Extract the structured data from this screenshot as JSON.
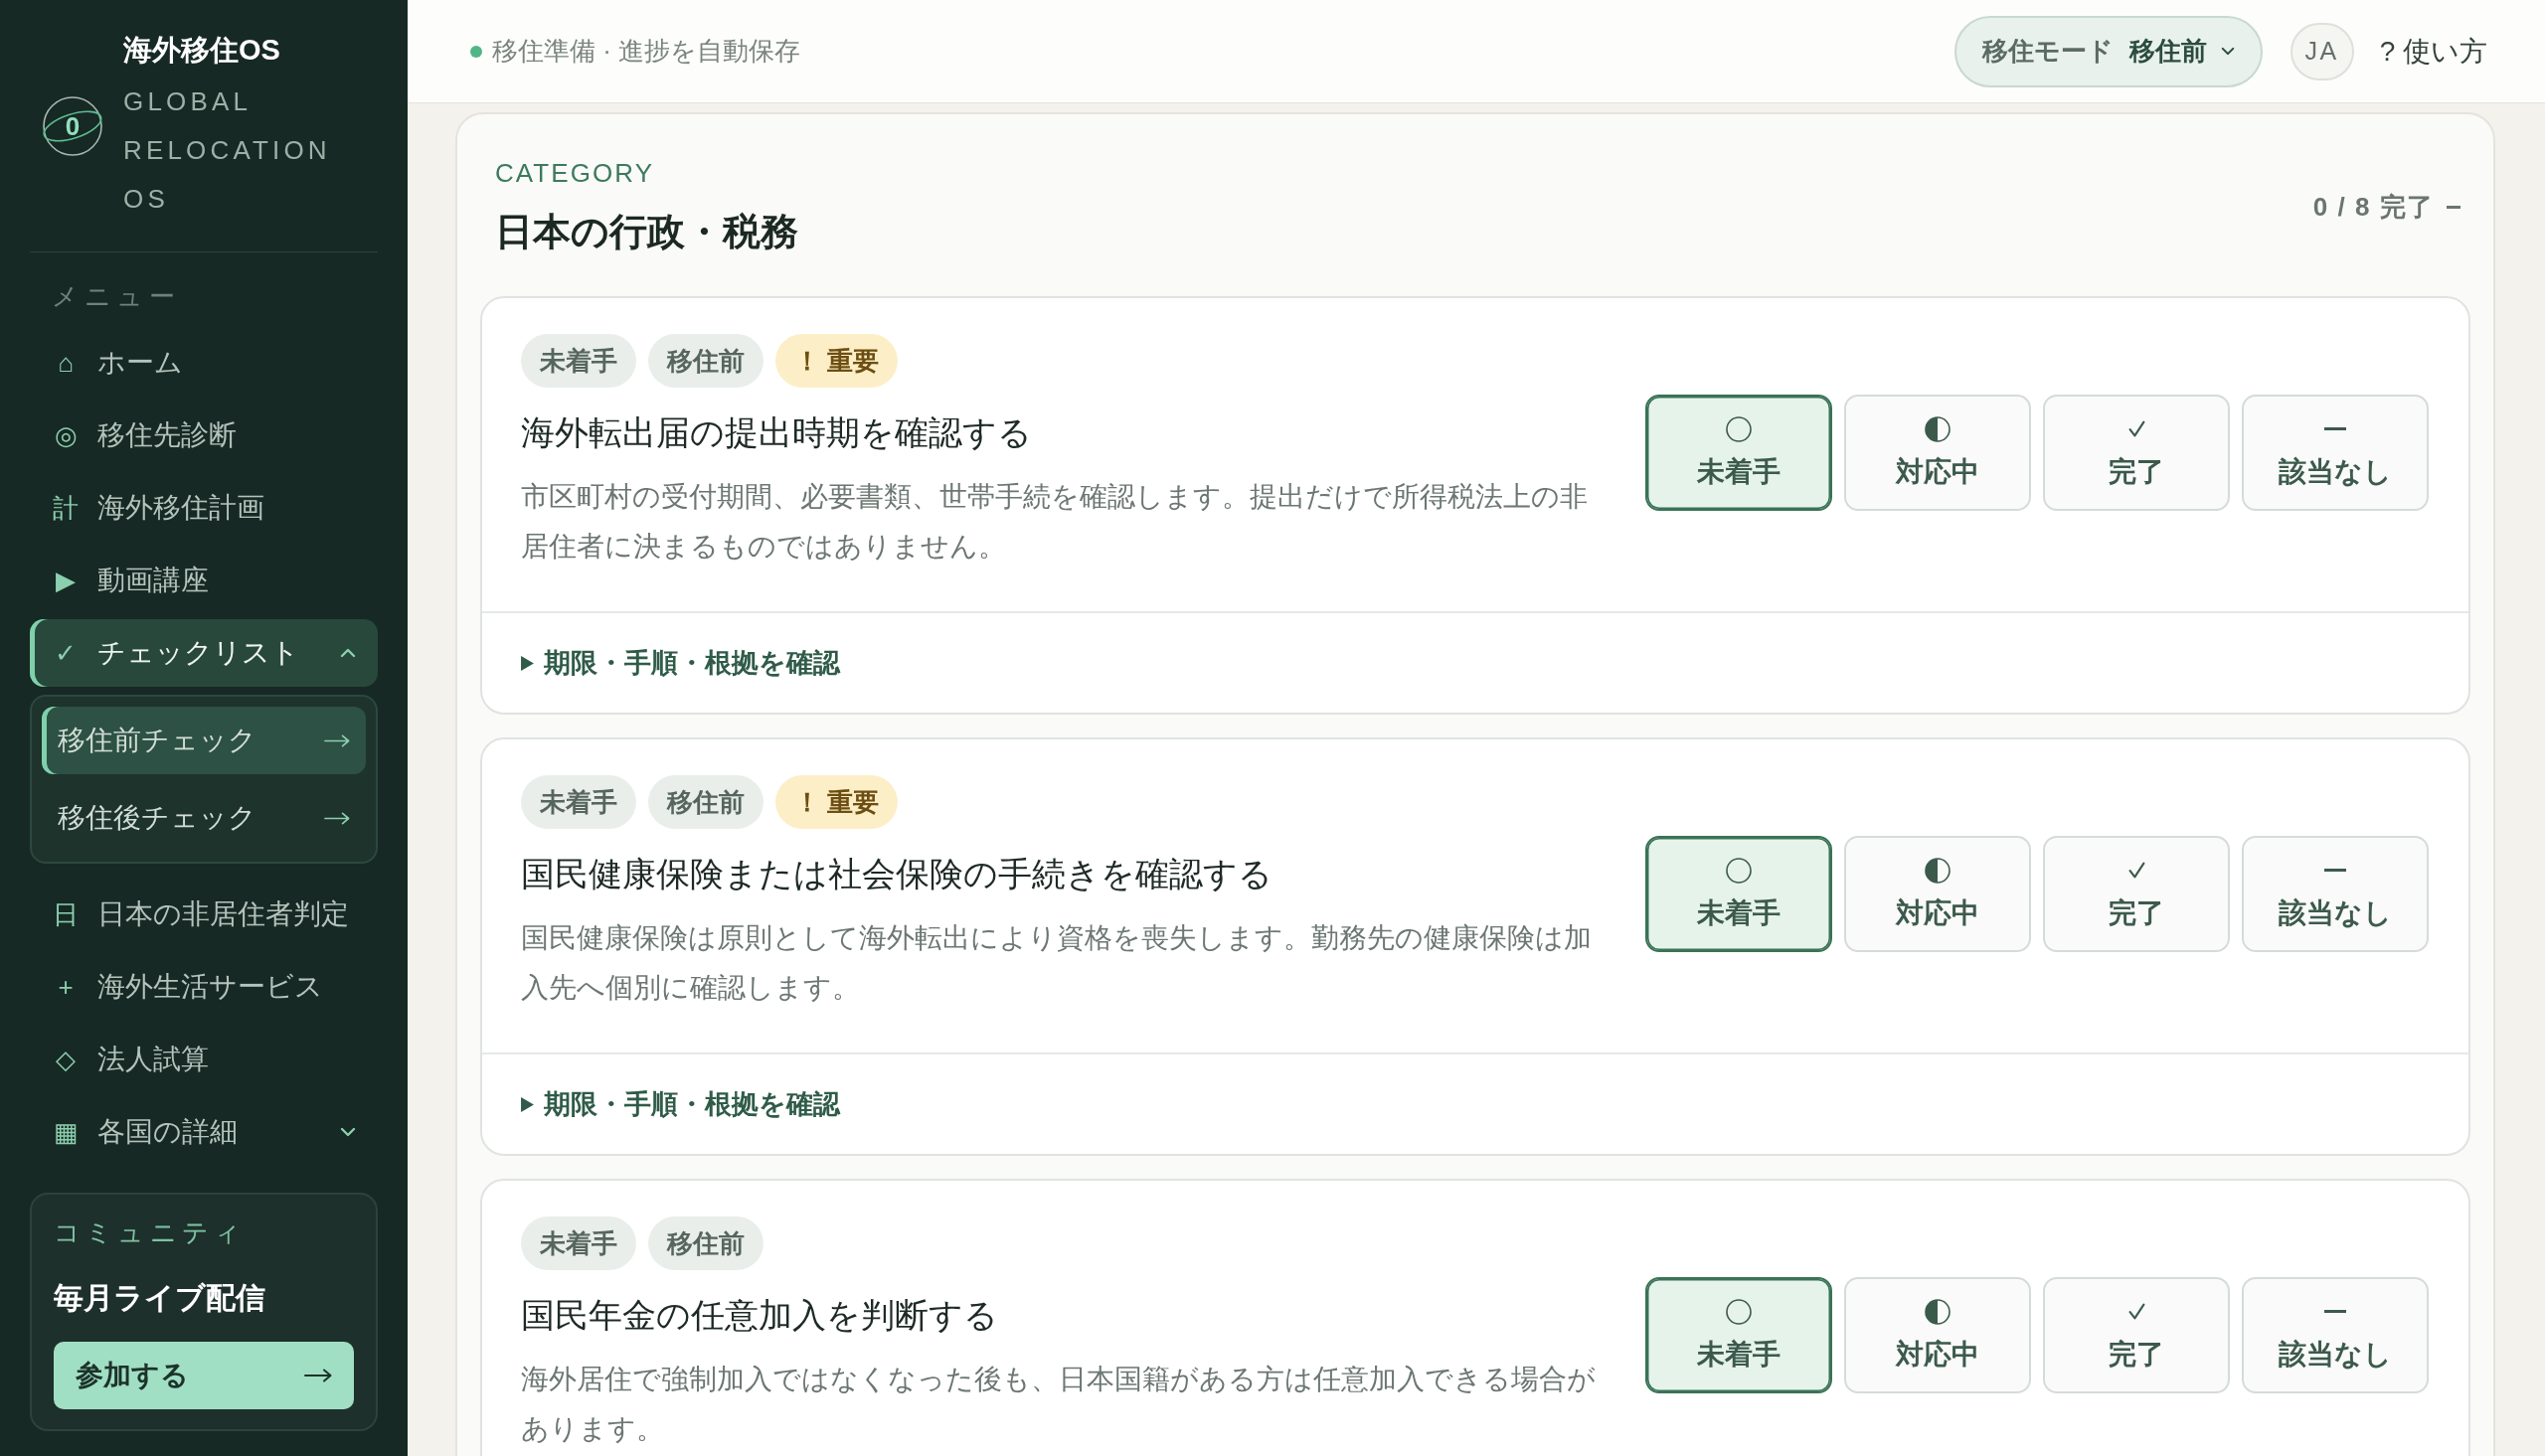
{
  "sidebar": {
    "brand": {
      "mark": "0",
      "title": "海外移住OS",
      "subtitle": "GLOBAL RELOCATION OS"
    },
    "menu_label": "メニュー",
    "items": [
      {
        "icon": "⌂",
        "label": "ホーム",
        "selected": false
      },
      {
        "icon": "◎",
        "label": "移住先診断",
        "selected": false
      },
      {
        "icon": "計",
        "label": "海外移住計画",
        "selected": false
      },
      {
        "icon": "▶",
        "label": "動画講座",
        "selected": false
      },
      {
        "icon": "✓",
        "label": "チェックリスト",
        "selected": true,
        "expanded": true,
        "children": [
          {
            "label": "移住前チェック",
            "selected": true
          },
          {
            "label": "移住後チェック",
            "selected": false
          }
        ]
      },
      {
        "icon": "日",
        "label": "日本の非居住者判定",
        "selected": false
      },
      {
        "icon": "+",
        "label": "海外生活サービス",
        "selected": false
      },
      {
        "icon": "◇",
        "label": "法人試算",
        "selected": false
      },
      {
        "icon": "▦",
        "label": "各国の詳細",
        "selected": false,
        "expanded": false
      }
    ],
    "community": {
      "label": "コミュニティ",
      "title": "毎月ライブ配信",
      "button": "参加する"
    }
  },
  "top_bar": {
    "status": "移住準備 · 進捗を自動保存",
    "mode": {
      "label": "移住モード",
      "value": "移住前"
    },
    "language": "JA",
    "help": "? 使い方"
  },
  "category": {
    "eyebrow": "CATEGORY",
    "title": "日本の行政・税務",
    "progress": "0 / 8 完了",
    "tasks": [
      {
        "tags": [
          {
            "label": "未着手",
            "kind": "status"
          },
          {
            "label": "移住前",
            "kind": "phase"
          },
          {
            "label": "！ 重要",
            "kind": "important"
          }
        ],
        "title": "海外転出届の提出時期を確認する",
        "description": "市区町村の受付期間、必要書類、世帯手続を確認します。提出だけで所得税法上の非居住者に決まるものではありません。",
        "status_options": [
          {
            "kind": "not_started",
            "label": "未着手",
            "selected": true
          },
          {
            "kind": "in_progress",
            "label": "対応中",
            "selected": false
          },
          {
            "kind": "done",
            "label": "完了",
            "selected": false
          },
          {
            "kind": "not_applicable",
            "label": "該当なし",
            "selected": false
          }
        ],
        "details": {
          "label": "期限・手順・根拠を確認",
          "expanded": false
        }
      },
      {
        "tags": [
          {
            "label": "未着手",
            "kind": "status"
          },
          {
            "label": "移住前",
            "kind": "phase"
          },
          {
            "label": "！ 重要",
            "kind": "important"
          }
        ],
        "title": "国民健康保険または社会保険の手続きを確認する",
        "description": "国民健康保険は原則として海外転出により資格を喪失します。勤務先の健康保険は加入先へ個別に確認します。",
        "status_options": [
          {
            "kind": "not_started",
            "label": "未着手",
            "selected": true
          },
          {
            "kind": "in_progress",
            "label": "対応中",
            "selected": false
          },
          {
            "kind": "done",
            "label": "完了",
            "selected": false
          },
          {
            "kind": "not_applicable",
            "label": "該当なし",
            "selected": false
          }
        ],
        "details": {
          "label": "期限・手順・根拠を確認",
          "expanded": false
        }
      },
      {
        "tags": [
          {
            "label": "未着手",
            "kind": "status"
          },
          {
            "label": "移住前",
            "kind": "phase"
          }
        ],
        "title": "国民年金の任意加入を判断する",
        "description": "海外居住で強制加入ではなくなった後も、日本国籍がある方は任意加入できる場合があります。",
        "status_options": [
          {
            "kind": "not_started",
            "label": "未着手",
            "selected": true
          },
          {
            "kind": "in_progress",
            "label": "対応中",
            "selected": false
          },
          {
            "kind": "done",
            "label": "完了",
            "selected": false
          },
          {
            "kind": "not_applicable",
            "label": "該当なし",
            "selected": false
          }
        ]
      }
    ]
  }
}
